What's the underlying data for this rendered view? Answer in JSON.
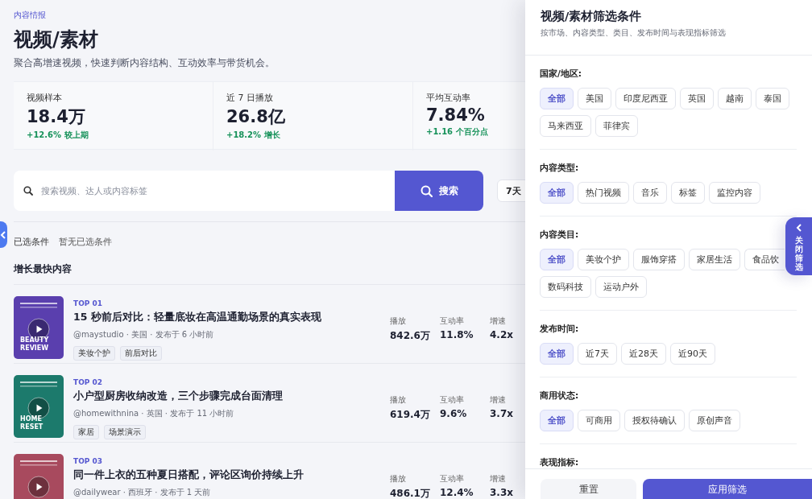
{
  "header": {
    "eyebrow": "内容情报",
    "title": "视频/素材",
    "subtitle": "聚合高增速视频，快速判断内容结构、互动效率与带货机会。"
  },
  "stats": [
    {
      "label": "视频样本",
      "value": "18.4万",
      "change": "+12.6% 较上期"
    },
    {
      "label": "近 7 日播放",
      "value": "26.8亿",
      "change": "+18.2% 增长"
    },
    {
      "label": "平均互动率",
      "value": "7.84%",
      "change": "+1.16 个百分点"
    }
  ],
  "search": {
    "placeholder": "搜索视频、达人或内容标签",
    "button": "搜索"
  },
  "period_chip": "7天",
  "selected_filters": {
    "label": "已选条件",
    "value": "暂无已选条件"
  },
  "list": {
    "title": "增长最快内容",
    "items": [
      {
        "rank": "TOP 01",
        "title": "15 秒前后对比：轻量底妆在高温通勤场景的真实表现",
        "meta": "@maystudio · 美国 · 发布于 6 小时前",
        "tags": [
          "美妆个护",
          "前后对比"
        ],
        "color": "#5a3fae",
        "caption": "BEAUTY REVIEW",
        "metrics": [
          {
            "label": "播放",
            "value": "842.6万"
          },
          {
            "label": "互动率",
            "value": "11.8%"
          },
          {
            "label": "增速",
            "value": "4.2x"
          }
        ]
      },
      {
        "rank": "TOP 02",
        "title": "小户型厨房收纳改造，三个步骤完成台面清理",
        "meta": "@homewithnina · 英国 · 发布于 11 小时前",
        "tags": [
          "家居",
          "场景演示"
        ],
        "color": "#1c7a6c",
        "caption": "HOME RESET",
        "metrics": [
          {
            "label": "播放",
            "value": "619.4万"
          },
          {
            "label": "互动率",
            "value": "9.6%"
          },
          {
            "label": "增速",
            "value": "3.7x"
          }
        ]
      },
      {
        "rank": "TOP 03",
        "title": "同一件上衣的五种夏日搭配，评论区询价持续上升",
        "meta": "@dailywear · 西班牙 · 发布于 1 天前",
        "color": "#a84a5e",
        "metrics": [
          {
            "label": "播放",
            "value": "486.1万"
          },
          {
            "label": "互动率",
            "value": "12.4%"
          },
          {
            "label": "增速",
            "value": "3.3x"
          }
        ]
      }
    ]
  },
  "filter_panel": {
    "title": "视频/素材筛选条件",
    "subtitle": "按市场、内容类型、类目、发布时间与表现指标筛选",
    "groups": [
      {
        "label": "国家/地区:",
        "options": [
          {
            "label": "全部",
            "selected": true
          },
          {
            "label": "美国",
            "selected": false
          },
          {
            "label": "印度尼西亚",
            "selected": false
          },
          {
            "label": "英国",
            "selected": false
          },
          {
            "label": "越南",
            "selected": false
          },
          {
            "label": "泰国",
            "selected": false
          },
          {
            "label": "马来西亚",
            "selected": false
          },
          {
            "label": "菲律宾",
            "selected": false
          }
        ]
      },
      {
        "label": "内容类型:",
        "options": [
          {
            "label": "全部",
            "selected": true
          },
          {
            "label": "热门视频",
            "selected": false
          },
          {
            "label": "音乐",
            "selected": false
          },
          {
            "label": "标签",
            "selected": false
          },
          {
            "label": "监控内容",
            "selected": false
          }
        ]
      },
      {
        "label": "内容类目:",
        "options": [
          {
            "label": "全部",
            "selected": true
          },
          {
            "label": "美妆个护",
            "selected": false
          },
          {
            "label": "服饰穿搭",
            "selected": false
          },
          {
            "label": "家居生活",
            "selected": false
          },
          {
            "label": "食品饮",
            "selected": false
          },
          {
            "label": "数码科技",
            "selected": false
          },
          {
            "label": "运动户外",
            "selected": false
          }
        ]
      },
      {
        "label": "发布时间:",
        "options": [
          {
            "label": "全部",
            "selected": true
          },
          {
            "label": "近7天",
            "selected": false
          },
          {
            "label": "近28天",
            "selected": false
          },
          {
            "label": "近90天",
            "selected": false
          }
        ]
      },
      {
        "label": "商用状态:",
        "options": [
          {
            "label": "全部",
            "selected": true
          },
          {
            "label": "可商用",
            "selected": false
          },
          {
            "label": "授权待确认",
            "selected": false
          },
          {
            "label": "原创声音",
            "selected": false
          }
        ]
      },
      {
        "label": "表现指标:"
      }
    ],
    "reset": "重置",
    "apply": "应用筛选",
    "close_tab": "关闭筛选"
  }
}
